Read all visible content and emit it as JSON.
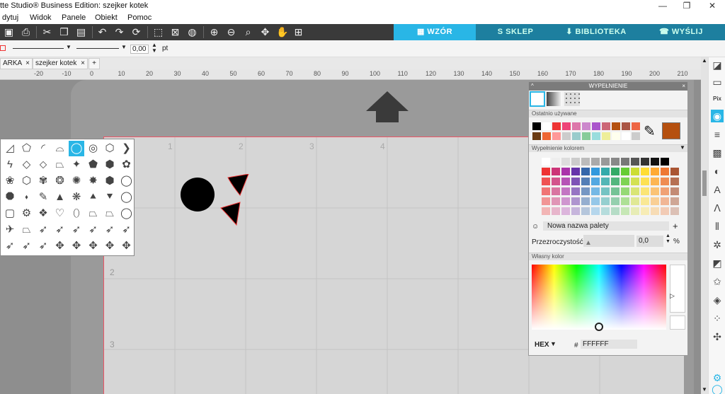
{
  "window": {
    "title": "tte Studio® Business Edition: szejker kotek",
    "minimize": "—",
    "maximize": "❐",
    "close": "✕"
  },
  "menu": [
    "dytuj",
    "Widok",
    "Panele",
    "Obiekt",
    "Pomoc"
  ],
  "nav_tabs": [
    {
      "label": "WZÓR",
      "icon": "grid-icon",
      "active": true
    },
    {
      "label": "SKLEP",
      "icon": "store-icon",
      "active": false
    },
    {
      "label": "BIBLIOTEKA",
      "icon": "library-icon",
      "active": false
    },
    {
      "label": "WYŚLIJ",
      "icon": "send-icon",
      "active": false
    }
  ],
  "line_bar": {
    "width_value": "0,00",
    "unit": "pt"
  },
  "doc_tabs": [
    "ARKA",
    "szejker kotek"
  ],
  "ruler": {
    "labels": [
      "-20",
      "-10",
      "0",
      "10",
      "20",
      "30",
      "40",
      "50",
      "60",
      "70",
      "80",
      "90",
      "100",
      "110",
      "120",
      "130",
      "140",
      "150",
      "160",
      "170",
      "180",
      "190",
      "200",
      "210"
    ]
  },
  "page_grid_labels": [
    "1",
    "2",
    "3",
    "4",
    "2",
    "3"
  ],
  "fill_panel": {
    "title": "WYPEŁNIENIE",
    "recent_title": "Ostatnio używane",
    "color_fill_title": "Wypełnienie kolorem",
    "palette_name": "Nowa nazwa palety",
    "transparency_label": "Przezroczystość",
    "transparency_value": "0,0",
    "transparency_unit": "%",
    "custom_color_title": "Własny kolor",
    "hex_label": "HEX",
    "hash": "#",
    "hex_value": "FFFFFF",
    "current_color": "#b5500f"
  },
  "colors": {
    "accent": "#1aa8d8",
    "toolbar_bg": "#3a3a3a",
    "nav_tab_bg": "#1f8fb4",
    "nav_tab_active": "#29b6e6",
    "shape_fill": "#000000",
    "page_edge": "#e05060"
  }
}
